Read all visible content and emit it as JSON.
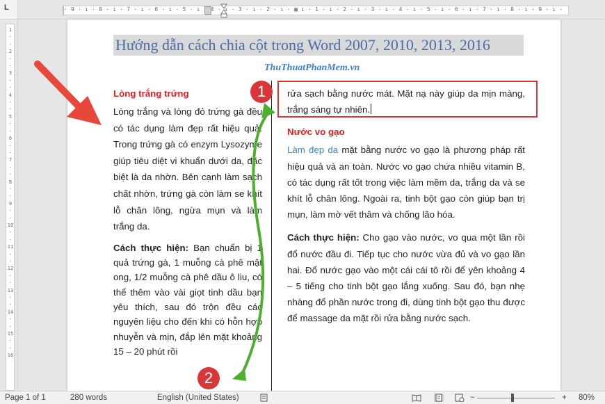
{
  "ruler": {
    "corner": "L",
    "top_ticks": "· 9 · ı · 8 · ı · 7 · ı · 6 · ı · 5 · ı · 4 · ı · 3 · ı · 2 · ı ·   ▦   ı · 1 · ı · 2 · ı · 3 · ı · 4 · ı · 5 · ı · 6 · ı · 7 · ı · 8 · ı · 9 · ı ·   ·11·",
    "left_ticks": [
      "1",
      "·",
      "·",
      "2",
      "·",
      "·",
      "3",
      "·",
      "·",
      "4",
      "·",
      "·",
      "5",
      "·",
      "·",
      "6",
      "·",
      "·",
      "7",
      "·",
      "·",
      "8",
      "·",
      "·",
      "9",
      "·",
      "·",
      "10",
      "·",
      "·",
      "11",
      "·",
      "·",
      "12",
      "·",
      "·",
      "13",
      "·",
      "·",
      "14",
      "·",
      "·",
      "15",
      "·",
      "·",
      "16"
    ]
  },
  "document": {
    "title": "Hướng dẫn cách chia cột trong Word 2007, 2010, 2013, 2016",
    "watermark": "ThuThuatPhanMem.vn",
    "left_column": {
      "heading": "Lòng trắng trứng",
      "para1": "Lòng trắng và lòng đỏ trứng gà đều có tác dụng làm đẹp rất hiệu quả. Trong trứng gà có enzym Lysozyme giúp tiêu diệt vi khuẩn dưới da, đặc biệt là da nhờn. Bên cạnh làm sạch chất nhờn, trứng gà còn làm se khít lỗ chân lông, ngừa mụn và làm trắng da.",
      "para2_bold": "Cách thực hiện:",
      "para2": " Bạn chuẩn bị 1 quả trứng gà, 1 muỗng cà phê mật ong, 1/2 muỗng cà phê dầu ô liu, có thể thêm vào vài giọt tinh dầu bạn yêu thích, sau đó trộn đều các nguyên liệu cho đến khi có hỗn hợp nhuyễn và mịn, đắp lên mặt khoảng 15 – 20 phút rồi"
    },
    "right_column": {
      "top_text": "rửa sạch bằng nước mát. Mặt nạ này giúp da mịn màng, trắng sáng tự nhiên.",
      "heading": "Nước vo gạo",
      "para1_link": "Làm đẹp da",
      "para1": " mặt bằng nước vo gạo là phương pháp rất hiệu quả và an toàn. Nước vo gạo chứa nhiều vitamin B, có tác dụng rất tốt trong việc làm mềm da, trắng da và se khít lỗ chân lông. Ngoài ra, tinh bột gạo còn giúp bạn trị mụn, làm mờ vết thâm và chống lão hóa.",
      "para2_bold": "Cách thực hiện:",
      "para2": " Cho gạo vào nước, vo qua một lần rồi đổ nước đầu đi. Tiếp tục cho nước vừa đủ và vo gạo lần hai. Đổ nước gạo vào một cái cái tô rồi để yên khoảng 4 – 5 tiếng cho tinh bột gạo lắng xuống. Sau đó, bạn nhẹ nhàng đổ phần nước trong đi, dùng tinh bột gạo thu được để massage da mặt rồi rửa bằng nước sạch."
    }
  },
  "annotations": {
    "badge1": "1",
    "badge2": "2",
    "colors": {
      "red": "#d9363a",
      "green": "#4caf2e",
      "title_blue": "#4a6da7",
      "link_blue": "#3b88c9"
    }
  },
  "statusbar": {
    "page": "Page 1 of 1",
    "words": "280 words",
    "language": "English (United States)",
    "zoom_minus": "−",
    "zoom_plus": "+",
    "zoom": "80%",
    "zoom_level": 0.8,
    "icons": [
      "proofing-icon",
      "read-mode-icon",
      "print-layout-icon",
      "web-layout-icon"
    ]
  }
}
